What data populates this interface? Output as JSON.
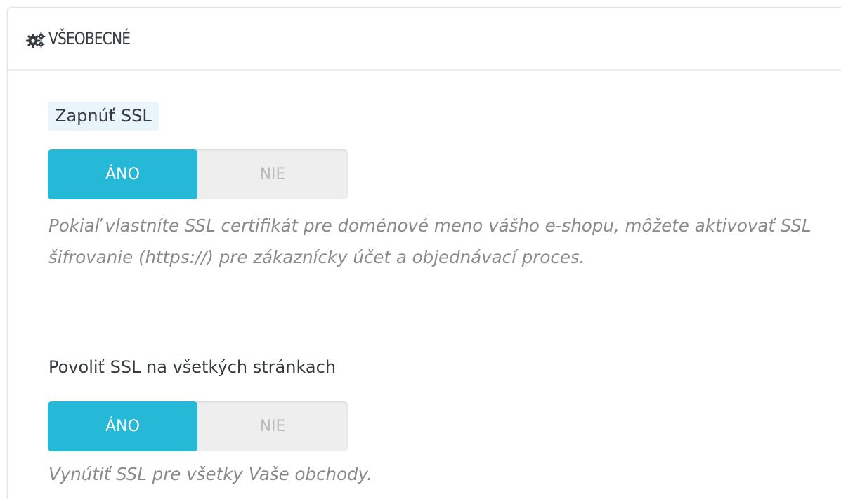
{
  "panel": {
    "heading": "VŠEOBECNÉ",
    "heading_icon": "gears-icon"
  },
  "fields": [
    {
      "label": "Zapnúť SSL",
      "options": {
        "yes": "ÁNO",
        "no": "NIE"
      },
      "selected": "yes",
      "help": "Pokiaľ vlastníte SSL certifikát pre doménové meno vášho e-shopu, môžete aktivovať SSL šifrovanie (https://) pre zákaznícky účet a objednávací proces."
    },
    {
      "label": "Povoliť SSL na všetkých stránkach",
      "options": {
        "yes": "ÁNO",
        "no": "NIE"
      },
      "selected": "yes",
      "help": "Vynútiť SSL pre všetky Vaše obchody."
    }
  ],
  "colors": {
    "accent": "#25b9d7",
    "label_hint_bg": "#eaf5fb",
    "help_text": "#8a8a8a",
    "inactive_option": "#bbbbbb"
  }
}
